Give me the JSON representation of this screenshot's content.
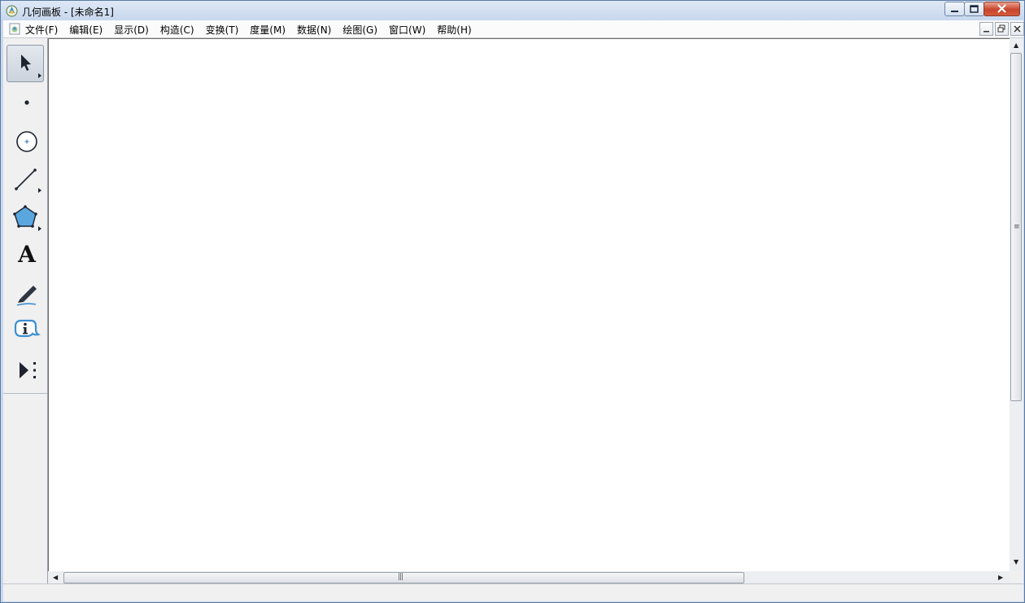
{
  "window": {
    "title": "几何画板 - [未命名1]"
  },
  "menubar": {
    "items": [
      "文件(F)",
      "编辑(E)",
      "显示(D)",
      "构造(C)",
      "变换(T)",
      "度量(M)",
      "数据(N)",
      "绘图(G)",
      "窗口(W)",
      "帮助(H)"
    ]
  },
  "toolbox": {
    "text_tool_glyph": "A",
    "tools": [
      "arrow-select-tool",
      "point-tool",
      "compass-tool",
      "straightedge-tool",
      "polygon-tool",
      "text-tool",
      "marker-tool",
      "information-tool",
      "custom-tools"
    ],
    "selected": "arrow-select-tool"
  },
  "colors": {
    "titlebar": "#c6d6ec",
    "accent": "#5aa7e0",
    "close_button": "#c7452c"
  }
}
